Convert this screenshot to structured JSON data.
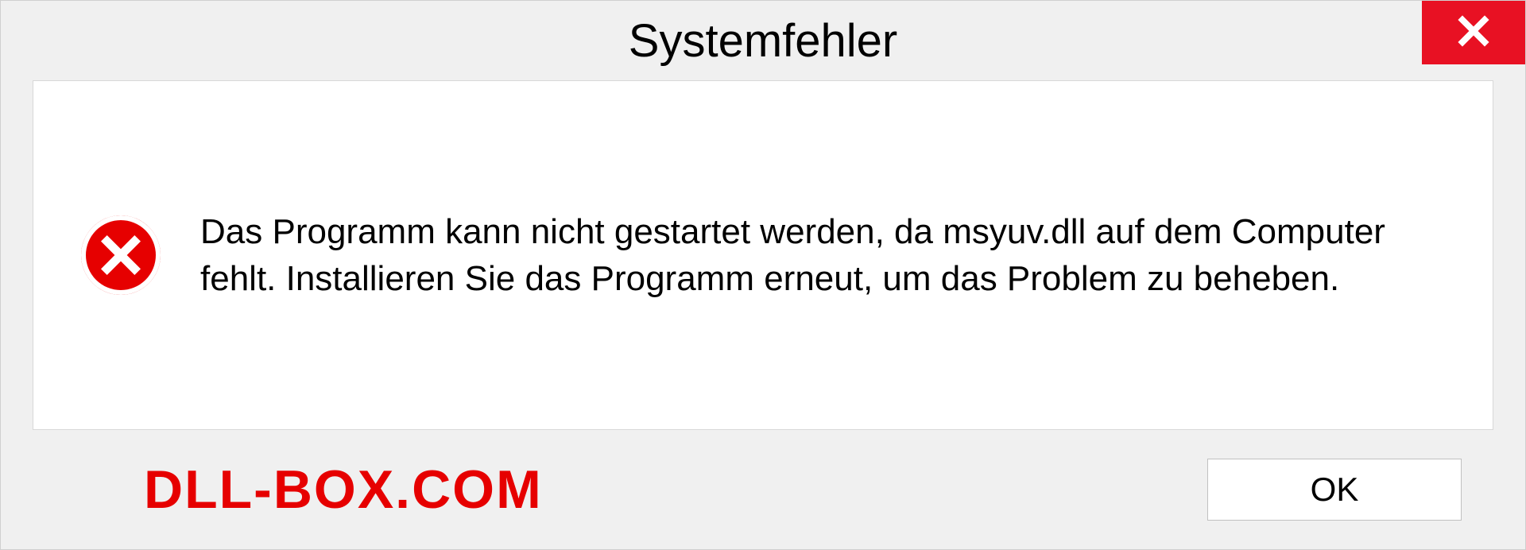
{
  "titlebar": {
    "title": "Systemfehler"
  },
  "body": {
    "error_message": "Das Programm kann nicht gestartet werden, da msyuv.dll auf dem Computer fehlt. Installieren Sie das Programm erneut, um das Problem zu beheben."
  },
  "footer": {
    "watermark": "DLL-BOX.COM",
    "ok_label": "OK"
  }
}
